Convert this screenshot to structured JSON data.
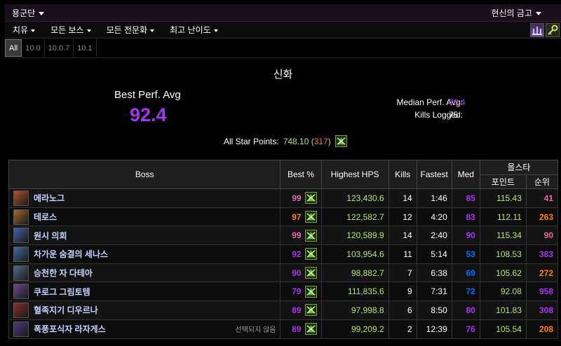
{
  "topbar": {
    "title": "용군단",
    "right_title": "현신의 금고"
  },
  "menu": {
    "items": [
      "치유",
      "모든 보스",
      "모든 전문화",
      "최고 난이도"
    ]
  },
  "tabs": [
    "All",
    "10.0",
    "10.0.7",
    "10.1"
  ],
  "summary": {
    "title": "신화",
    "best_perf_label": "Best Perf. Avg",
    "best_perf_value": "92.4",
    "median_label": "Median Perf. Avg:",
    "median_value": "76.4",
    "kills_label": "Kills Logged:",
    "kills_value": "75",
    "all_star_label": "All Star Points:",
    "all_star_points": "748.10",
    "all_star_open": "(",
    "all_star_rank": "317",
    "all_star_close": ")"
  },
  "table": {
    "headers": {
      "boss": "Boss",
      "best": "Best %",
      "hps": "Highest HPS",
      "kills": "Kills",
      "fastest": "Fastest",
      "med": "Med",
      "allstar": "올스타",
      "points": "포인트",
      "rank": "순위"
    },
    "rows": [
      {
        "name": "에라노그",
        "note": "",
        "best": "99",
        "hps": "123,430.6",
        "kills": "14",
        "fastest": "1:46",
        "med": "85",
        "points": "115.43",
        "rank": "41"
      },
      {
        "name": "테로스",
        "note": "",
        "best": "97",
        "hps": "122,582.7",
        "kills": "12",
        "fastest": "4:20",
        "med": "83",
        "points": "112.11",
        "rank": "263"
      },
      {
        "name": "원시 의회",
        "note": "",
        "best": "99",
        "hps": "120,589.9",
        "kills": "14",
        "fastest": "2:40",
        "med": "90",
        "points": "115.34",
        "rank": "90"
      },
      {
        "name": "차가운 숨결의 세나스",
        "note": "",
        "best": "92",
        "hps": "103,954.6",
        "kills": "11",
        "fastest": "5:14",
        "med": "53",
        "points": "108.53",
        "rank": "383"
      },
      {
        "name": "승천한 자 다테아",
        "note": "",
        "best": "90",
        "hps": "98,882.7",
        "kills": "7",
        "fastest": "6:38",
        "med": "69",
        "points": "105.62",
        "rank": "272"
      },
      {
        "name": "쿠로그 그림토템",
        "note": "",
        "best": "79",
        "hps": "111,835.6",
        "kills": "9",
        "fastest": "7:31",
        "med": "72",
        "points": "92.08",
        "rank": "958"
      },
      {
        "name": "혈족지기 디우르나",
        "note": "",
        "best": "89",
        "hps": "97,998.8",
        "kills": "6",
        "fastest": "8:50",
        "med": "80",
        "points": "101.83",
        "rank": "308"
      },
      {
        "name": "폭풍포식자 라자게스",
        "note": "선택되지 않음",
        "best": "89",
        "hps": "99,209.2",
        "kills": "2",
        "fastest": "12:39",
        "med": "76",
        "points": "105.54",
        "rank": "208"
      }
    ]
  },
  "colors": {
    "legendary": "#ff8000",
    "epic": "#a335ee",
    "rare": "#0070ff",
    "astounding": "#e268a8",
    "hps_green": "#b7e37b",
    "boss_name": "#c7d2ff"
  }
}
